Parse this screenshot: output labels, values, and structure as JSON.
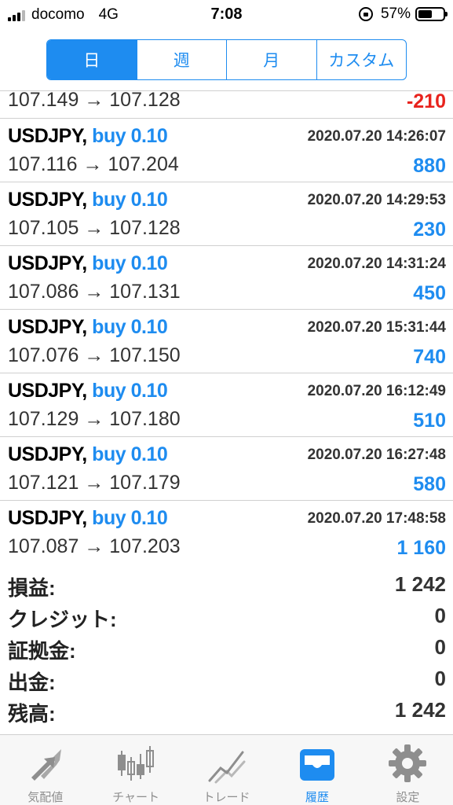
{
  "status_bar": {
    "carrier": "docomo",
    "network": "4G",
    "time": "7:08",
    "battery": "57%",
    "battery_level": 0.57
  },
  "period_tabs": [
    "日",
    "週",
    "月",
    "カスタム"
  ],
  "active_period": "日",
  "partial_row": {
    "prices": "107.149 → 107.128",
    "profit": "-210"
  },
  "trades": [
    {
      "symbol": "USDJPY,",
      "side": "buy 0.10",
      "date": "2020.07.20 14:26:07",
      "prices": "107.116 → 107.204",
      "profit": "880"
    },
    {
      "symbol": "USDJPY,",
      "side": "buy 0.10",
      "date": "2020.07.20 14:29:53",
      "prices": "107.105 → 107.128",
      "profit": "230"
    },
    {
      "symbol": "USDJPY,",
      "side": "buy 0.10",
      "date": "2020.07.20 14:31:24",
      "prices": "107.086 → 107.131",
      "profit": "450"
    },
    {
      "symbol": "USDJPY,",
      "side": "buy 0.10",
      "date": "2020.07.20 15:31:44",
      "prices": "107.076 → 107.150",
      "profit": "740"
    },
    {
      "symbol": "USDJPY,",
      "side": "buy 0.10",
      "date": "2020.07.20 16:12:49",
      "prices": "107.129 → 107.180",
      "profit": "510"
    },
    {
      "symbol": "USDJPY,",
      "side": "buy 0.10",
      "date": "2020.07.20 16:27:48",
      "prices": "107.121 → 107.179",
      "profit": "580"
    },
    {
      "symbol": "USDJPY,",
      "side": "buy 0.10",
      "date": "2020.07.20 17:48:58",
      "prices": "107.087 → 107.203",
      "profit": "1 160"
    }
  ],
  "summary": [
    {
      "label": "損益:",
      "value": "1 242"
    },
    {
      "label": "クレジット:",
      "value": "0"
    },
    {
      "label": "証拠金:",
      "value": "0"
    },
    {
      "label": "出金:",
      "value": "0"
    },
    {
      "label": "残高:",
      "value": "1 242"
    }
  ],
  "tabbar": [
    {
      "label": "気配値",
      "icon": "quotes-arrows-icon"
    },
    {
      "label": "チャート",
      "icon": "candlestick-chart-icon"
    },
    {
      "label": "トレード",
      "icon": "trade-line-chart-icon"
    },
    {
      "label": "履歴",
      "icon": "history-inbox-icon"
    },
    {
      "label": "設定",
      "icon": "gear-icon"
    }
  ],
  "active_tab": "履歴",
  "colors": {
    "accent": "#1e8cf0",
    "negative": "#e8231d",
    "inactive_icon": "#8e8e8e"
  }
}
